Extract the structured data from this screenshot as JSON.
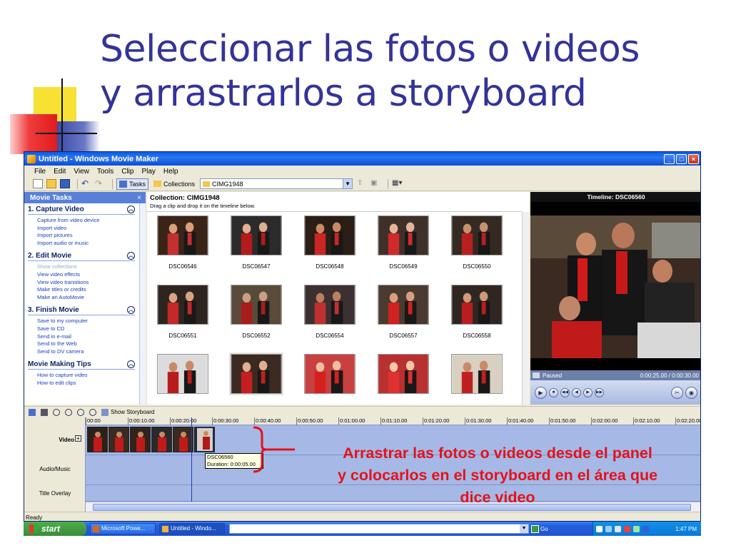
{
  "slide": {
    "title_line1": "Seleccionar las fotos o videos",
    "title_line2": "y arrastrarlos a storyboard"
  },
  "window": {
    "title": "Untitled - Windows Movie Maker"
  },
  "menu": [
    "File",
    "Edit",
    "View",
    "Tools",
    "Clip",
    "Play",
    "Help"
  ],
  "toolbar": {
    "tasks_label": "Tasks",
    "collections_label": "Collections",
    "collection_combo": "CIMG1948"
  },
  "task_pane": {
    "header": "Movie Tasks",
    "close": "×",
    "sections": [
      {
        "title": "1. Capture Video",
        "links": [
          {
            "label": "Capture from video device",
            "enabled": true
          },
          {
            "label": "Import video",
            "enabled": true
          },
          {
            "label": "Import pictures",
            "enabled": true
          },
          {
            "label": "Import audio or music",
            "enabled": true
          }
        ]
      },
      {
        "title": "2. Edit Movie",
        "links": [
          {
            "label": "Show collections",
            "enabled": false
          },
          {
            "label": "View video effects",
            "enabled": true
          },
          {
            "label": "View video transitions",
            "enabled": true
          },
          {
            "label": "Make titles or credits",
            "enabled": true
          },
          {
            "label": "Make an AutoMovie",
            "enabled": true
          }
        ]
      },
      {
        "title": "3. Finish Movie",
        "links": [
          {
            "label": "Save to my computer",
            "enabled": true
          },
          {
            "label": "Save to CD",
            "enabled": true
          },
          {
            "label": "Send in e-mail",
            "enabled": true
          },
          {
            "label": "Send to the Web",
            "enabled": true
          },
          {
            "label": "Send to DV camera",
            "enabled": true
          }
        ]
      },
      {
        "title": "Movie Making Tips",
        "links": [
          {
            "label": "How to capture video",
            "enabled": true
          },
          {
            "label": "How to edit clips",
            "enabled": true
          }
        ]
      }
    ]
  },
  "collection": {
    "title": "Collection: CIMG1948",
    "subtitle": "Drag a clip and drop it on the timeline below.",
    "clips": [
      "DSC06546",
      "DSC06547",
      "DSC06548",
      "DSC06549",
      "DSC06550",
      "DSC06551",
      "DSC06552",
      "DSC06554",
      "DSC06557",
      "DSC06558",
      "",
      "",
      "",
      "",
      ""
    ]
  },
  "preview": {
    "title": "Timeline: DSC06560",
    "status": "Paused",
    "time": "0:00:25.00 / 0:00:30.00"
  },
  "storyboard_toolbar": {
    "show_storyboard": "Show Storyboard"
  },
  "timeline": {
    "ruler": [
      "00:00",
      "0:00:10.00",
      "0:00:20.00",
      "0:00:30.00",
      "0:00:40.00",
      "0:00:50.00",
      "0:01:00.00",
      "0:01:10.00",
      "0:01:20.00",
      "0:01:30.00",
      "0:01:40.00",
      "0:01:50.00",
      "0:02:00.00",
      "0:02:10.00",
      "0:02:20.00"
    ],
    "tracks": {
      "video": "Video",
      "audio": "Audio/Music",
      "overlay": "Title Overlay"
    },
    "tooltip_name": "DSC06560",
    "tooltip_duration": "Duration:  0:00:05.00"
  },
  "status_bar": "Ready",
  "annotation": {
    "line1": "Arrastrar las fotos o videos desde el panel",
    "line2": "y colocarlos en el storyboard en el área que",
    "line3": "dice video"
  },
  "taskbar": {
    "start": "start",
    "items": [
      "Microsoft Powe...",
      "Untitled - Windo..."
    ],
    "go": "Go",
    "clock": "1:47 PM"
  },
  "colors": {
    "title_blue": "#333399",
    "annotation_red": "#e3131b",
    "xp_blue": "#245edc"
  }
}
